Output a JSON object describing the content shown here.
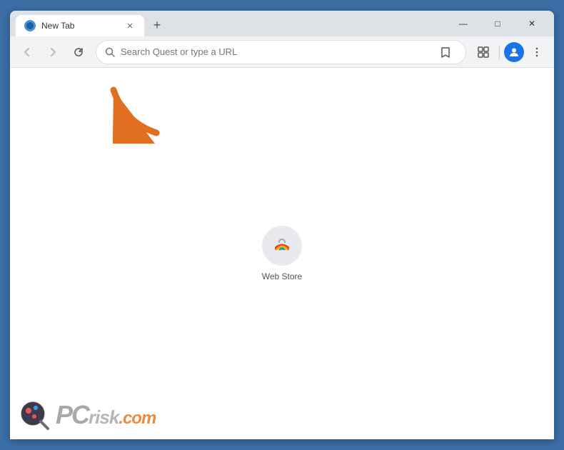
{
  "browser": {
    "tab": {
      "title": "New Tab",
      "favicon_alt": "Chrome favicon"
    },
    "new_tab_btn_label": "+",
    "window_controls": {
      "minimize": "—",
      "maximize": "□",
      "close": "✕"
    },
    "nav": {
      "back_title": "Back",
      "forward_title": "Forward",
      "reload_title": "Reload",
      "address_placeholder": "Search Quest or type a URL",
      "address_value": "",
      "bookmark_title": "Bookmark",
      "extensions_title": "Extensions",
      "profile_title": "Profile",
      "menu_title": "Menu"
    },
    "shortcuts": [
      {
        "label": "Web Store",
        "icon_type": "webstore"
      }
    ]
  },
  "watermark": {
    "site": "PCrisk.com",
    "site_domain": ".com"
  },
  "arrow": {
    "color": "#e07020",
    "pointing_at": "address bar"
  }
}
